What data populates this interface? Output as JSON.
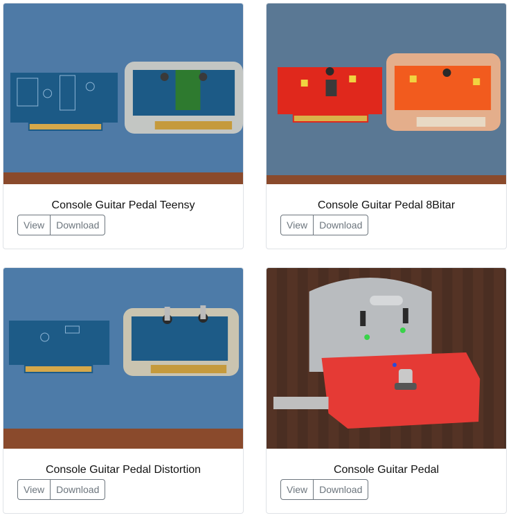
{
  "cards": [
    {
      "title": "Console Guitar Pedal Teensy",
      "view_label": "View",
      "download_label": "Download"
    },
    {
      "title": "Console Guitar Pedal 8Bitar",
      "view_label": "View",
      "download_label": "Download"
    },
    {
      "title": "Console Guitar Pedal Distortion",
      "view_label": "View",
      "download_label": "Download"
    },
    {
      "title": "Console Guitar Pedal",
      "view_label": "View",
      "download_label": "Download"
    }
  ],
  "colors": {
    "card_border": "#dfe2e6",
    "button_border": "#6c757d",
    "board_blue": "#1e5d8f",
    "board_red": "#e02a1e",
    "desk_blue": "#4b79a8",
    "desk_wood": "#5a3424"
  }
}
